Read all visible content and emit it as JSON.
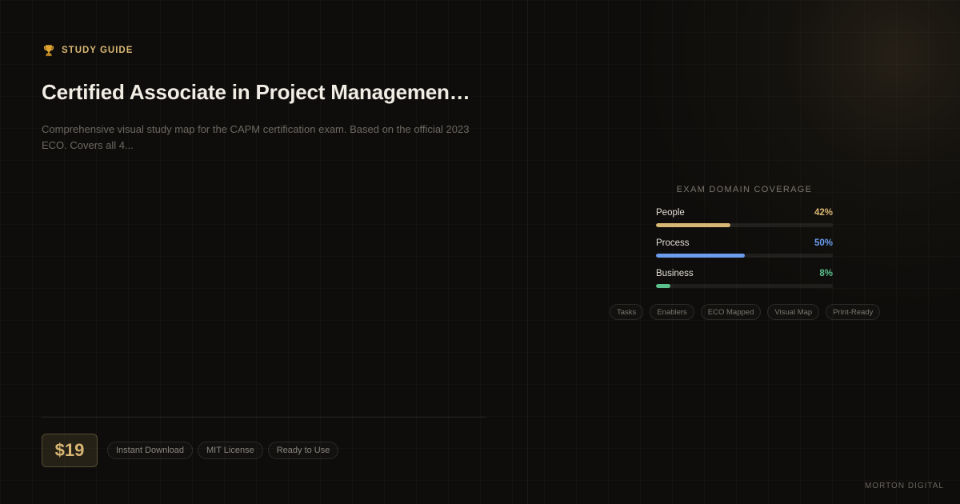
{
  "eyebrow": {
    "icon": "trophy-icon",
    "label": "STUDY GUIDE"
  },
  "title": "Certified Associate in Project Managemen…",
  "description": "Comprehensive visual study map for the CAPM certification exam. Based on the official 2023 ECO. Covers all 4...",
  "price": "$19",
  "features": [
    "Instant Download",
    "MIT License",
    "Ready to Use"
  ],
  "coverage": {
    "title": "EXAM DOMAIN COVERAGE",
    "domains": [
      {
        "name": "People",
        "percent_label": "42%",
        "percent": 42,
        "color": "#d8b673"
      },
      {
        "name": "Process",
        "percent_label": "50%",
        "percent": 50,
        "color": "#6b9cee"
      },
      {
        "name": "Business",
        "percent_label": "8%",
        "percent": 8,
        "color": "#5cc08c"
      }
    ]
  },
  "tags": [
    "Tasks",
    "Enablers",
    "ECO Mapped",
    "Visual Map",
    "Print-Ready"
  ],
  "brand": "MORTON DIGITAL",
  "colors": {
    "accent": "#d8b673",
    "background": "#0e0d0b"
  }
}
